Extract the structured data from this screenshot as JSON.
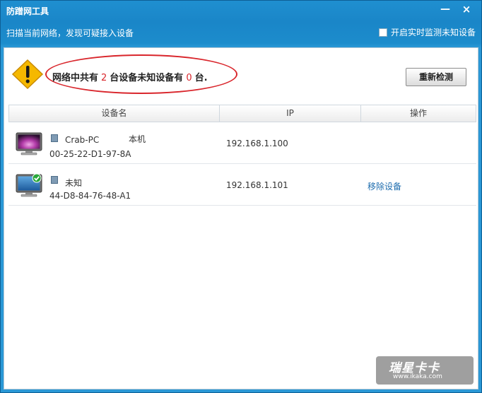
{
  "window": {
    "title": "防蹭网工具",
    "minimize_glyph": "—",
    "close_glyph": "×"
  },
  "subbar": {
    "subtitle": "扫描当前网络，发现可疑接入设备",
    "monitor_label": "开启实时监测未知设备",
    "monitor_checked": false
  },
  "summary": {
    "prefix": "网络中共有",
    "total": "2",
    "middle": "台设备未知设备有",
    "unknown": "0",
    "suffix": "台.",
    "rescan_label": "重新检测",
    "warning_icon": "warning-triangle-icon"
  },
  "table": {
    "columns": [
      "设备名",
      "IP",
      "操作"
    ],
    "rows": [
      {
        "name": "Crab-PC",
        "tag": "本机",
        "mac": "00-25-22-D1-97-8A",
        "ip": "192.168.1.100",
        "action": "",
        "icon": "computer-pink-icon"
      },
      {
        "name": "未知",
        "tag": "",
        "mac": "44-D8-84-76-48-A1",
        "ip": "192.168.1.101",
        "action": "移除设备",
        "icon": "computer-blue-check-icon"
      }
    ]
  },
  "watermark": {
    "big": "瑞星卡卡",
    "small": "www.ikaka.com"
  },
  "colors": {
    "titlebar": "#1a86c8",
    "highlight_red": "#d9262c",
    "link_blue": "#1d6cae"
  }
}
